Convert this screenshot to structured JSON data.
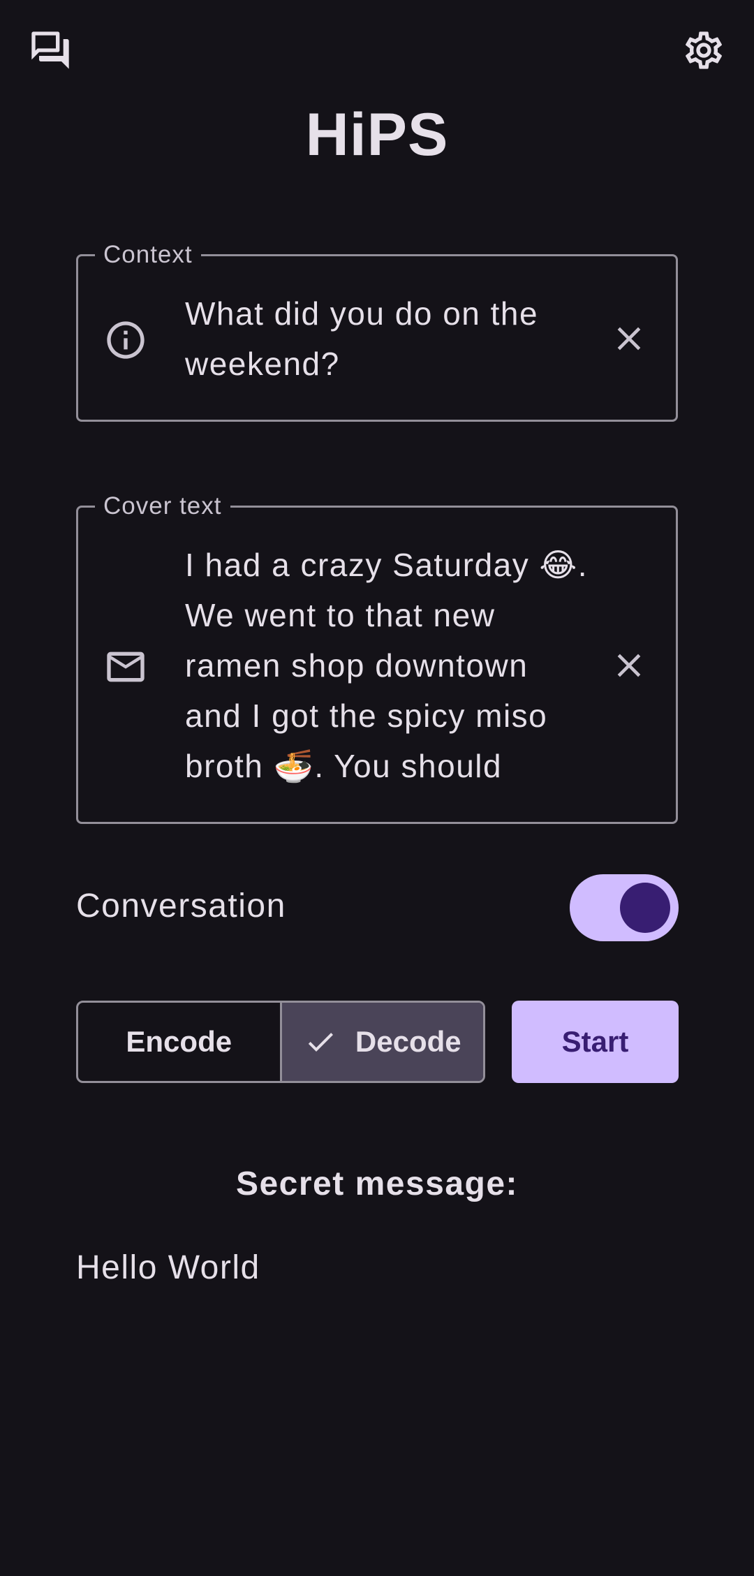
{
  "header": {
    "title": "HiPS",
    "left_icon": "conversations-icon",
    "right_icon": "gear-icon"
  },
  "context_field": {
    "label": "Context",
    "value": "What did you do on the weekend?",
    "leading_icon": "info-icon",
    "trailing_icon": "close-icon"
  },
  "cover_field": {
    "label": "Cover text",
    "value": "I had a crazy Saturday 😂. We went to that new ramen shop downtown and I got the spicy miso broth 🍜. You should",
    "leading_icon": "mail-icon",
    "trailing_icon": "close-icon"
  },
  "conversation_toggle": {
    "label": "Conversation",
    "checked": true
  },
  "mode_selector": {
    "options": [
      "Encode",
      "Decode"
    ],
    "selected": "Decode"
  },
  "start_button": {
    "label": "Start"
  },
  "secret": {
    "heading": "Secret message:",
    "value": "Hello World"
  },
  "colors": {
    "background": "#141218",
    "on_surface": "#E6E0E9",
    "outline": "#938F99",
    "primary": "#D0BCFF",
    "on_primary": "#381E72",
    "secondary_container": "#4A4458"
  }
}
